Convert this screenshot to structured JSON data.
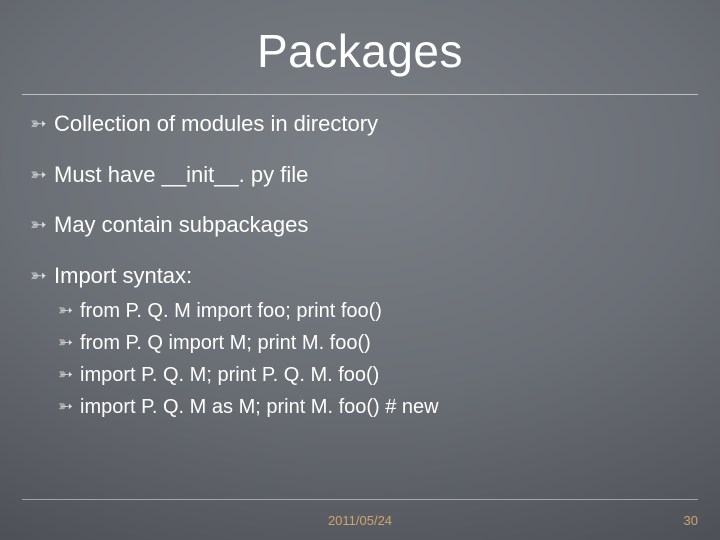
{
  "title": "Packages",
  "bullets": [
    {
      "text": "Collection of modules in directory"
    },
    {
      "text": "Must have __init__. py file"
    },
    {
      "text": "May contain subpackages"
    },
    {
      "text": "Import syntax:"
    }
  ],
  "sub_bullets": [
    {
      "text": "from P. Q. M import foo; print foo()"
    },
    {
      "text": "from P. Q import M; print M. foo()"
    },
    {
      "text": "import P. Q. M; print P. Q. M. foo()"
    },
    {
      "text": "import P. Q. M as M; print M. foo()   # new"
    }
  ],
  "footer": {
    "date": "2011/05/24",
    "page": "30"
  }
}
